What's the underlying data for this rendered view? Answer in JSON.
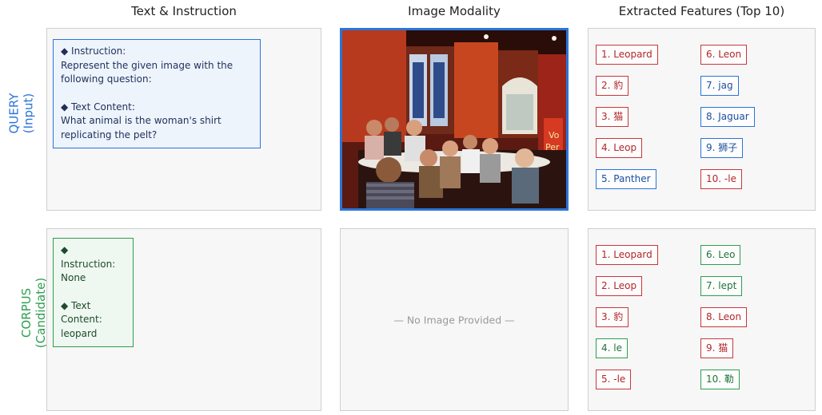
{
  "column_headers": {
    "text": "Text & Instruction",
    "image": "Image Modality",
    "features": "Extracted Features (Top 10)"
  },
  "rows": {
    "query": {
      "label_line1": "QUERY",
      "label_line2": "(Input)",
      "color": "#2b74d8"
    },
    "corpus": {
      "label_line1": "CORPUS",
      "label_line2": "(Candidate)",
      "color": "#2e9e4f"
    }
  },
  "query": {
    "instruction_heading": "◆ Instruction:",
    "instruction_text": "Represent the given image with the following question:",
    "content_heading": "◆ Text Content:",
    "content_text": "What animal is the woman's shirt replicating the pelt?",
    "features": [
      {
        "label": "1. Leopard",
        "color": "red"
      },
      {
        "label": "2. 豹",
        "color": "red"
      },
      {
        "label": "3. 猫",
        "color": "red"
      },
      {
        "label": "4. Leop",
        "color": "red"
      },
      {
        "label": "5. Panther",
        "color": "blue"
      },
      {
        "label": "6. Leon",
        "color": "red"
      },
      {
        "label": "7. jag",
        "color": "blue"
      },
      {
        "label": "8. Jaguar",
        "color": "blue"
      },
      {
        "label": "9. 狮子",
        "color": "blue"
      },
      {
        "label": "10. -le",
        "color": "red"
      }
    ]
  },
  "corpus": {
    "instruction_heading": "◆ Instruction:",
    "instruction_text": "None",
    "content_heading": "◆ Text Content:",
    "content_text": "leopard",
    "no_image_text": "— No Image Provided —",
    "features": [
      {
        "label": "1. Leopard",
        "color": "red"
      },
      {
        "label": "2. Leop",
        "color": "red"
      },
      {
        "label": "3. 豹",
        "color": "red"
      },
      {
        "label": "4. le",
        "color": "green"
      },
      {
        "label": "5. -le",
        "color": "red"
      },
      {
        "label": "6. Leo",
        "color": "green"
      },
      {
        "label": "7. lept",
        "color": "green"
      },
      {
        "label": "8. Leon",
        "color": "red"
      },
      {
        "label": "9. 猫",
        "color": "red"
      },
      {
        "label": "10. 勒",
        "color": "green"
      }
    ]
  },
  "colors": {
    "red": "#c8373b",
    "blue": "#2b74d8",
    "green": "#2e9e4f",
    "panel_bg": "#f7f7f7"
  }
}
